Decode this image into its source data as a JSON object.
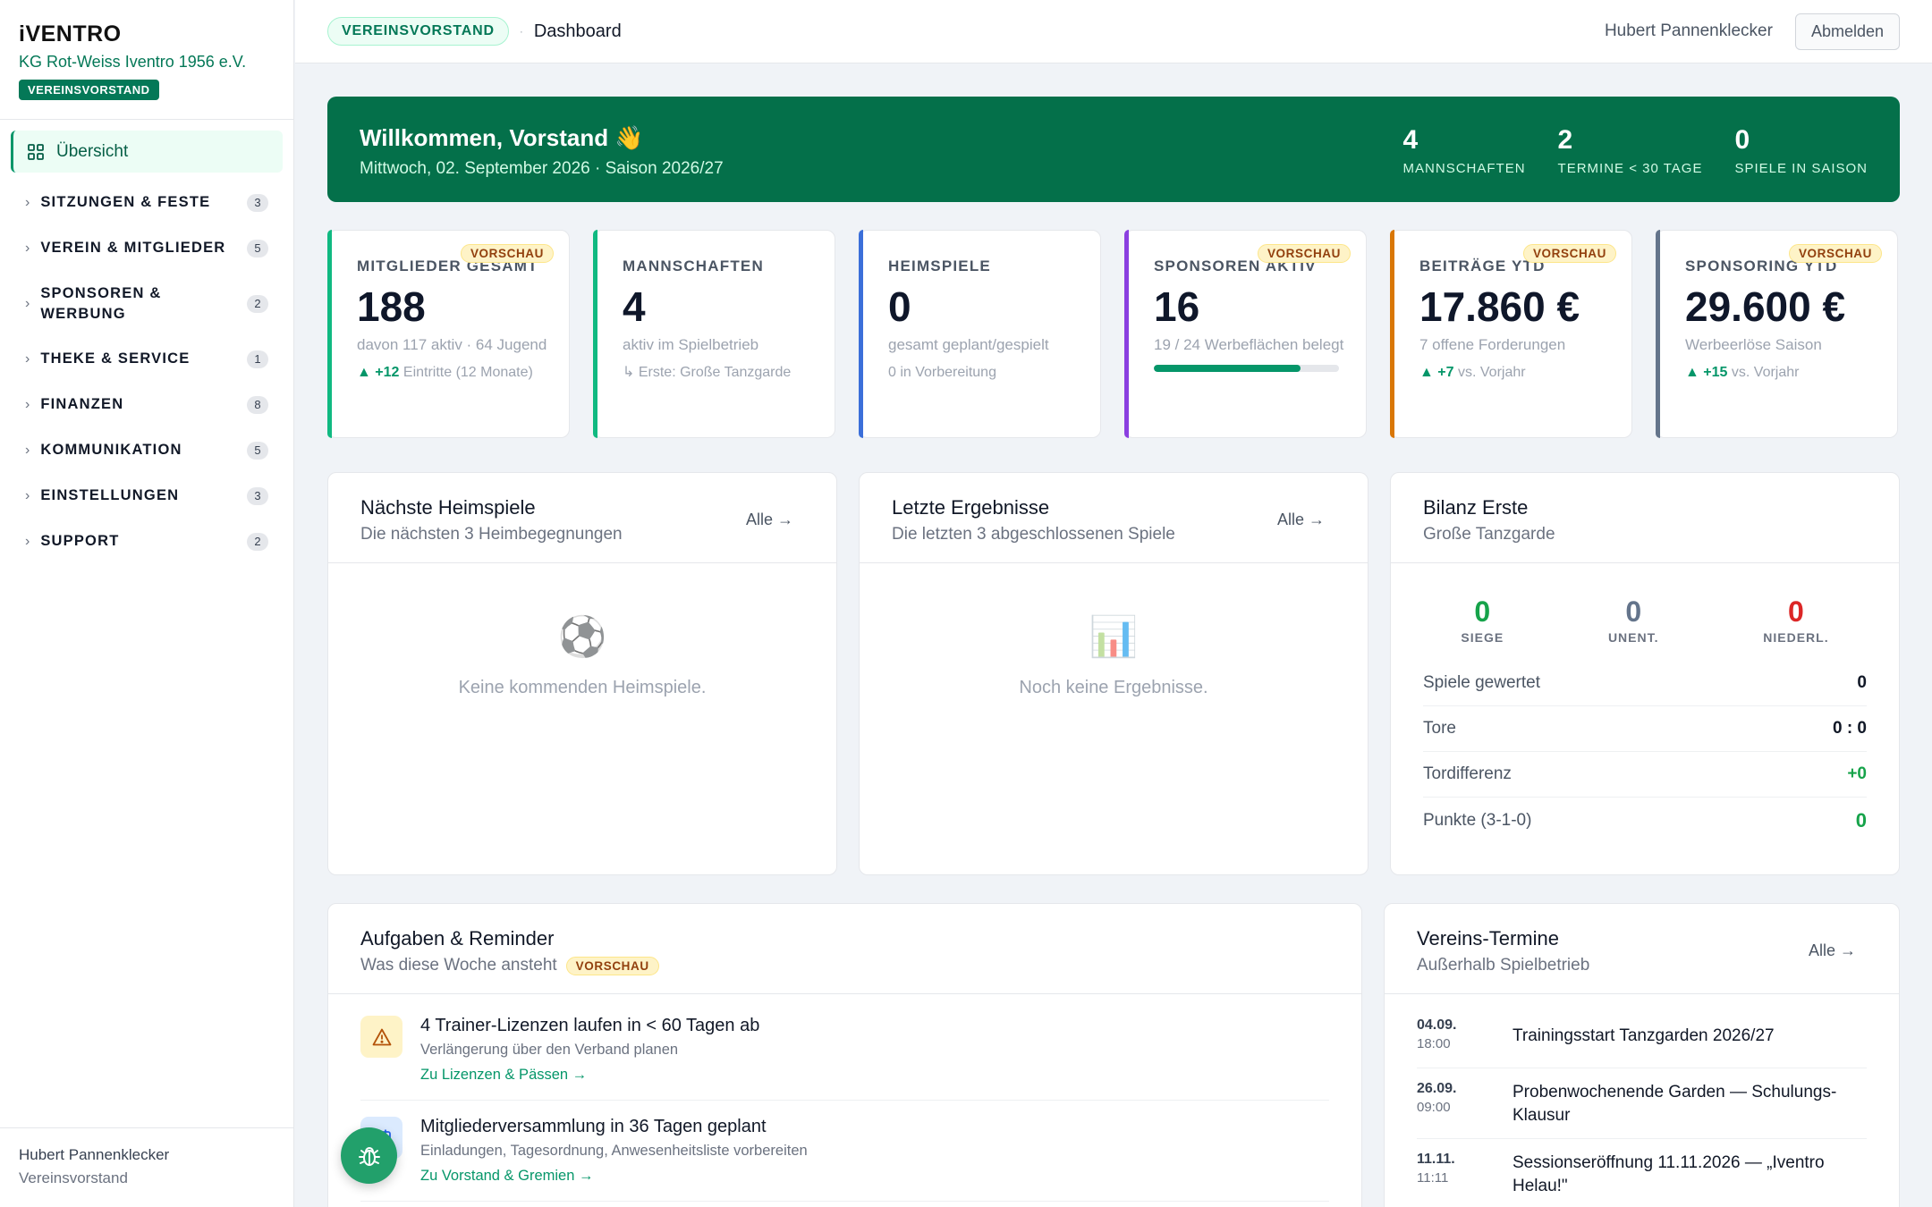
{
  "sidebar": {
    "logo": "iVENTRO",
    "org": "KG Rot-Weiss Iventro 1956 e.V.",
    "role": "VEREINSVORSTAND",
    "active": "Übersicht",
    "items": [
      {
        "label": "SITZUNGEN & FESTE",
        "count": "3"
      },
      {
        "label": "VEREIN & MITGLIEDER",
        "count": "5"
      },
      {
        "label": "SPONSOREN & WERBUNG",
        "count": "2"
      },
      {
        "label": "THEKE & SERVICE",
        "count": "1"
      },
      {
        "label": "FINANZEN",
        "count": "8"
      },
      {
        "label": "KOMMUNIKATION",
        "count": "5"
      },
      {
        "label": "EINSTELLUNGEN",
        "count": "3"
      },
      {
        "label": "SUPPORT",
        "count": "2"
      }
    ],
    "footer_name": "Hubert Pannenklecker",
    "footer_role": "Vereinsvorstand"
  },
  "topbar": {
    "pill": "VEREINSVORSTAND",
    "sep": "·",
    "crumb": "Dashboard",
    "user": "Hubert Pannenklecker",
    "logout": "Abmelden"
  },
  "hero": {
    "title": "Willkommen, Vorstand 👋",
    "subtitle": "Mittwoch, 02. September 2026 · Saison 2026/27",
    "stats": [
      {
        "value": "4",
        "label": "MANNSCHAFTEN"
      },
      {
        "value": "2",
        "label": "TERMINE < 30 TAGE"
      },
      {
        "value": "0",
        "label": "SPIELE IN SAISON"
      }
    ]
  },
  "kpis": [
    {
      "title": "MITGLIEDER GESAMT",
      "value": "188",
      "desc": "davon 117 aktiv · 64 Jugend",
      "badge": "VORSCHAU",
      "trend_arrow": "▲",
      "trend_num": "+12",
      "trend_text": "Eintritte (12 Monate)",
      "color": "#10b981"
    },
    {
      "title": "MANNSCHAFTEN",
      "value": "4",
      "desc": "aktiv im Spielbetrieb",
      "extra": "↳ Erste: Große Tanzgarde",
      "color": "#10b981"
    },
    {
      "title": "HEIMSPIELE",
      "value": "0",
      "desc": "gesamt geplant/gespielt",
      "extra": "0 in Vorbereitung",
      "color": "#3b6fd9"
    },
    {
      "title": "SPONSOREN AKTIV",
      "value": "16",
      "desc": "19 / 24 Werbeflächen belegt",
      "badge": "VORSCHAU",
      "progress": 0.79,
      "color": "#8b3fe0"
    },
    {
      "title": "BEITRÄGE YTD",
      "value": "17.860 €",
      "desc": "7 offene Forderungen",
      "badge": "VORSCHAU",
      "trend_arrow": "▲",
      "trend_num": "+7",
      "trend_text": "vs. Vorjahr",
      "color": "#d97706"
    },
    {
      "title": "SPONSORING YTD",
      "value": "29.600 €",
      "desc": "Werbeerlöse Saison",
      "badge": "VORSCHAU",
      "trend_arrow": "▲",
      "trend_num": "+15",
      "trend_text": "vs. Vorjahr",
      "color": "#64748b"
    }
  ],
  "home_games": {
    "title": "Nächste Heimspiele",
    "subtitle": "Die nächsten 3 Heimbegegnungen",
    "link": "Alle →",
    "icon": "⚽",
    "empty": "Keine kommenden Heimspiele."
  },
  "results": {
    "title": "Letzte Ergebnisse",
    "subtitle": "Die letzten 3 abgeschlossenen Spiele",
    "link": "Alle →",
    "icon": "📊",
    "empty": "Noch keine Ergebnisse."
  },
  "balance": {
    "title": "Bilanz Erste",
    "subtitle": "Große Tanzgarde",
    "wins": "0",
    "wins_label": "SIEGE",
    "draws": "0",
    "draws_label": "UNENT.",
    "losses": "0",
    "losses_label": "NIEDERL.",
    "rows": [
      {
        "k": "Spiele gewertet",
        "v": "0"
      },
      {
        "k": "Tore",
        "v": "0 : 0"
      },
      {
        "k": "Tordifferenz",
        "v": "+0"
      },
      {
        "k": "Punkte (3-1-0)",
        "v": "0"
      }
    ]
  },
  "tasks": {
    "title": "Aufgaben & Reminder",
    "subtitle": "Was diese Woche ansteht",
    "badge": "VORSCHAU",
    "items": [
      {
        "title": "4 Trainer-Lizenzen laufen in < 60 Tagen ab",
        "desc": "Verlängerung über den Verband planen",
        "link": "Zu Lizenzen & Pässen →"
      },
      {
        "title": "Mitgliederversammlung in 36 Tagen geplant",
        "desc": "Einladungen, Tagesordnung, Anwesenheitsliste vorbereiten",
        "link": "Zu Vorstand & Gremien →"
      }
    ]
  },
  "events": {
    "title": "Vereins-Termine",
    "subtitle": "Außerhalb Spielbetrieb",
    "link": "Alle →",
    "items": [
      {
        "date": "04.09.",
        "time": "18:00",
        "title": "Trainingsstart Tanzgarden 2026/27"
      },
      {
        "date": "26.09.",
        "time": "09:00",
        "title": "Probenwochenende Garden — Schulungs-Klausur"
      },
      {
        "date": "11.11.",
        "time": "11:11",
        "title": "Sessionseröffnung 11.11.2026 — „Iventro Helau!\""
      }
    ]
  }
}
